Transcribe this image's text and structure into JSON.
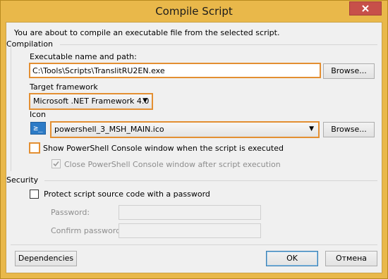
{
  "window": {
    "title": "Compile Script"
  },
  "intro": "You are about to compile an executable file from the selected script.",
  "compilation": {
    "group_label": "Compilation",
    "exe_label": "Executable name and path:",
    "exe_value": "C:\\Tools\\Scripts\\TranslitRU2EN.exe",
    "browse_label": "Browse...",
    "framework_label": "Target framework",
    "framework_value": "Microsoft .NET Framework 4.0",
    "icon_label": "Icon",
    "icon_value": "powershell_3_MSH_MAIN.ico",
    "icon_browse_label": "Browse...",
    "show_console_label": "Show PowerShell Console window when the script is executed",
    "close_console_label": "Close PowerShell Console window after script execution"
  },
  "security": {
    "group_label": "Security",
    "protect_label": "Protect script source code with a password",
    "password_label": "Password:",
    "confirm_label": "Confirm password:"
  },
  "footer": {
    "dependencies_label": "Dependencies",
    "ok_label": "OK",
    "cancel_label": "Отмена"
  }
}
